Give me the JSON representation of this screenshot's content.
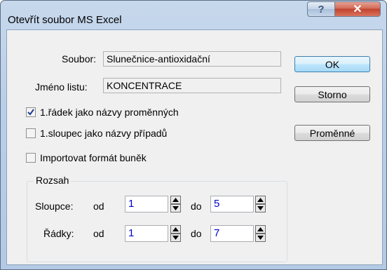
{
  "window": {
    "title": "Otevřít soubor MS Excel"
  },
  "titlebar": {
    "help_icon": "help-icon",
    "close_icon": "close-icon"
  },
  "file": {
    "label": "Soubor:",
    "value": "Slunečnice-antioxidační",
    "sheet_label": "Jméno listu:",
    "sheet_value": "KONCENTRACE"
  },
  "options": [
    {
      "label": "1.řádek jako názvy proměnných",
      "checked": true
    },
    {
      "label": "1.sloupec jako názvy případů",
      "checked": false
    },
    {
      "label": "Importovat formát buněk",
      "checked": false
    }
  ],
  "buttons": {
    "ok": "OK",
    "cancel": "Storno",
    "variables": "Proměnné"
  },
  "range": {
    "title": "Rozsah",
    "columns": {
      "label": "Sloupce:",
      "from_label": "od",
      "from": "1",
      "to_label": "do",
      "to": "5"
    },
    "rows": {
      "label": "Řádky:",
      "from_label": "od",
      "from": "1",
      "to_label": "do",
      "to": "7"
    }
  }
}
